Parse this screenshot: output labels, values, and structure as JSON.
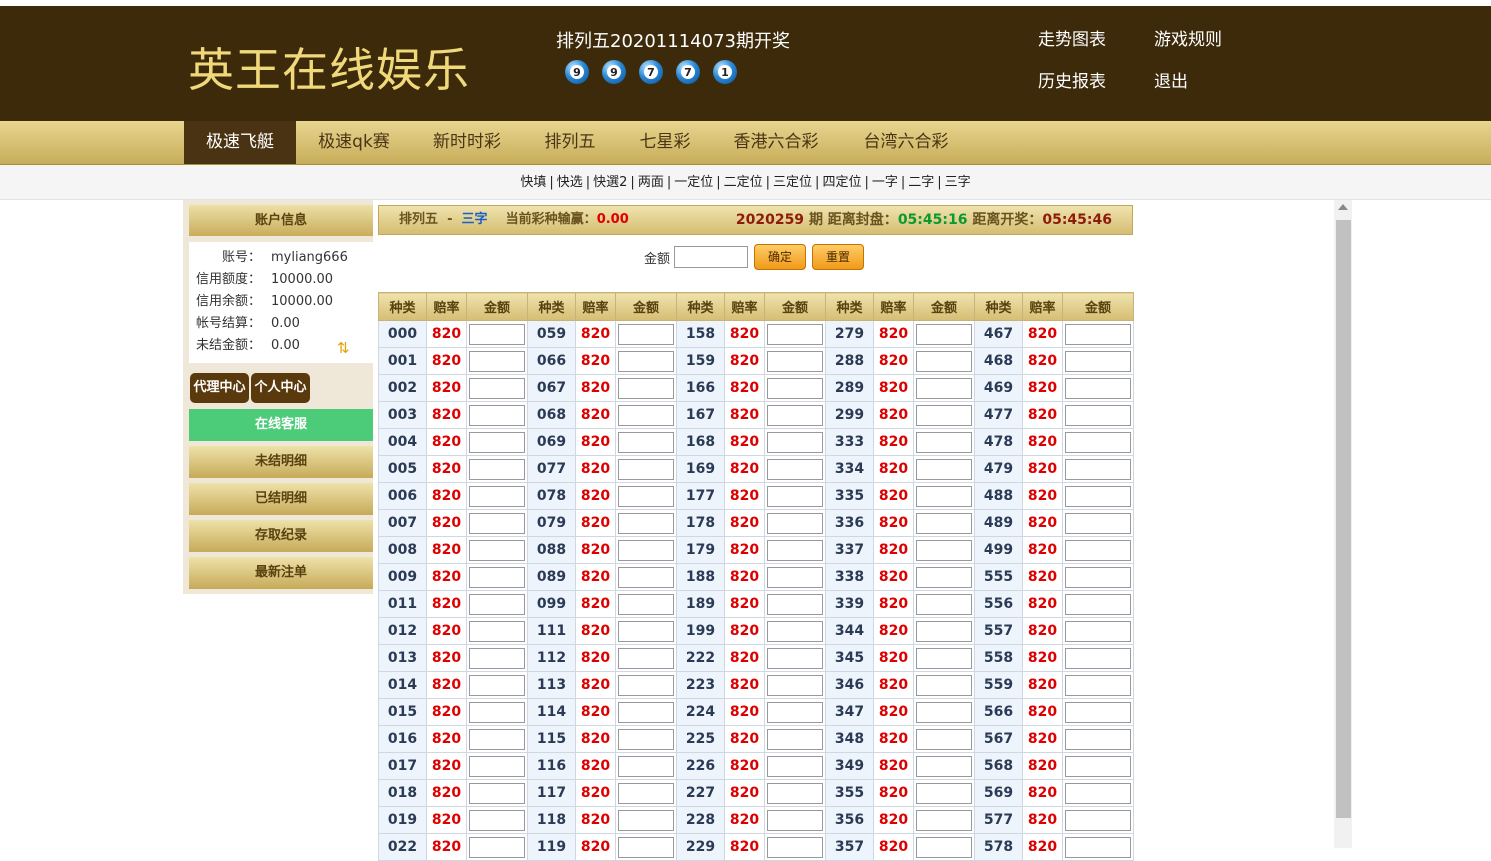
{
  "header": {
    "logo": "英王在线娱乐",
    "draw_title": "排列五20201114073期开奖",
    "balls": [
      "9",
      "9",
      "7",
      "7",
      "1"
    ],
    "links": [
      "走势图表",
      "游戏规则",
      "历史报表",
      "退出"
    ]
  },
  "nav": {
    "items": [
      "极速飞艇",
      "极速qk赛",
      "新时时彩",
      "排列五",
      "七星彩",
      "香港六合彩",
      "台湾六合彩"
    ],
    "active": "极速飞艇"
  },
  "subnav": [
    "快填",
    "快选",
    "快選2",
    "两面",
    "一定位",
    "二定位",
    "三定位",
    "四定位",
    "一字",
    "二字",
    "三字"
  ],
  "sidebar": {
    "title": "账户信息",
    "account": [
      {
        "k": "账号：",
        "v": "myliang666"
      },
      {
        "k": "信用额度：",
        "v": "10000.00"
      },
      {
        "k": "信用余额：",
        "v": "10000.00"
      },
      {
        "k": "帐号结算：",
        "v": "0.00"
      },
      {
        "k": "未结金额：",
        "v": "0.00"
      }
    ],
    "tabs": [
      "代理中心",
      "个人中心"
    ],
    "buttons": [
      "在线客服",
      "未结明细",
      "已结明细",
      "存取纪录",
      "最新注单"
    ]
  },
  "infobar": {
    "game": "排列五",
    "dash": "-",
    "play": "三字",
    "winloss_label": "当前彩种输赢：",
    "winloss_value": "0.00",
    "period": "2020259",
    "period_label": "期 距离封盘：",
    "close_time": "05:45:16",
    "open_label": "距离开奖：",
    "open_time": "05:45:46"
  },
  "amount": {
    "label": "金额",
    "confirm": "确定",
    "reset": "重置"
  },
  "table": {
    "headers": [
      "种类",
      "赔率",
      "金额"
    ],
    "odds": "820",
    "columns": [
      [
        "000",
        "001",
        "002",
        "003",
        "004",
        "005",
        "006",
        "007",
        "008",
        "009",
        "011",
        "012",
        "013",
        "014",
        "015",
        "016",
        "017",
        "018",
        "019",
        "022"
      ],
      [
        "059",
        "066",
        "067",
        "068",
        "069",
        "077",
        "078",
        "079",
        "088",
        "089",
        "099",
        "111",
        "112",
        "113",
        "114",
        "115",
        "116",
        "117",
        "118",
        "119"
      ],
      [
        "158",
        "159",
        "166",
        "167",
        "168",
        "169",
        "177",
        "178",
        "179",
        "188",
        "189",
        "199",
        "222",
        "223",
        "224",
        "225",
        "226",
        "227",
        "228",
        "229"
      ],
      [
        "279",
        "288",
        "289",
        "299",
        "333",
        "334",
        "335",
        "336",
        "337",
        "338",
        "339",
        "344",
        "345",
        "346",
        "347",
        "348",
        "349",
        "355",
        "356",
        "357"
      ],
      [
        "467",
        "468",
        "469",
        "477",
        "478",
        "479",
        "488",
        "489",
        "499",
        "555",
        "556",
        "557",
        "558",
        "559",
        "566",
        "567",
        "568",
        "569",
        "577",
        "578"
      ]
    ]
  }
}
